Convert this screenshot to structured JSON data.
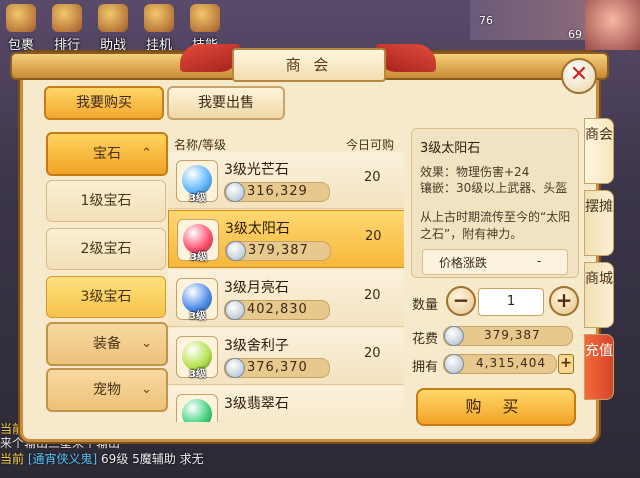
{
  "hud": {
    "top_icons": [
      "包裹",
      "排行",
      "助战",
      "挂机",
      "技能"
    ],
    "badge_a": "76",
    "badge_b": "69"
  },
  "window": {
    "title": "商 会",
    "close_glyph": "✕"
  },
  "tabs": {
    "buy": "我要购买",
    "sell": "我要出售"
  },
  "categories": [
    {
      "label": "宝石",
      "chevron": "⌃"
    },
    {
      "label": "1级宝石"
    },
    {
      "label": "2级宝石"
    },
    {
      "label": "3级宝石"
    },
    {
      "label": "装备",
      "chevron": "⌄"
    },
    {
      "label": "宠物",
      "chevron": "⌄"
    }
  ],
  "list": {
    "col_name": "名称/等级",
    "col_count": "今日可购",
    "items": [
      {
        "name": "3级光芒石",
        "level": "3级",
        "price": "316,329",
        "count": "20",
        "gem_color": "#5ab4ff"
      },
      {
        "name": "3级太阳石",
        "level": "3级",
        "price": "379,387",
        "count": "20",
        "gem_color": "#ff4a6a"
      },
      {
        "name": "3级月亮石",
        "level": "3级",
        "price": "402,830",
        "count": "20",
        "gem_color": "#4a8ae8"
      },
      {
        "name": "3级舍利子",
        "level": "3级",
        "price": "376,370",
        "count": "20",
        "gem_color": "#b4e04a"
      },
      {
        "name": "3级翡翠石",
        "level": "3级",
        "price": "",
        "count": "",
        "gem_color": "#3ad07a"
      }
    ]
  },
  "detail": {
    "title": "3级太阳石",
    "effect": "效果：物理伤害+24",
    "inlay": "镶嵌：30级以上武器、头盔",
    "desc": "从上古时期流传至今的“太阳之石”，附有神力。",
    "trend_label": "价格涨跌",
    "trend_value": "-"
  },
  "purchase": {
    "qty_label": "数量",
    "qty_value": "1",
    "minus": "−",
    "plus": "+",
    "cost_label": "花费",
    "cost_value": "379,387",
    "own_label": "拥有",
    "own_value": "4,315,404",
    "add": "+",
    "buy_label": "购 买"
  },
  "side_tabs": [
    {
      "label": "商会"
    },
    {
      "label": "摆摊"
    },
    {
      "label": "商城"
    },
    {
      "label": "充值"
    }
  ],
  "chat": {
    "line1": "当前",
    "line2": "来个输出三星来个输出",
    "line3_tag": "当前",
    "line3_name": "[通宵侠义鬼]",
    "line3_rest": "69级  5魔辅助  求无"
  },
  "colors": {
    "accent": "#f2a326",
    "panel": "#f7e9cc",
    "danger": "#d21e1e"
  }
}
